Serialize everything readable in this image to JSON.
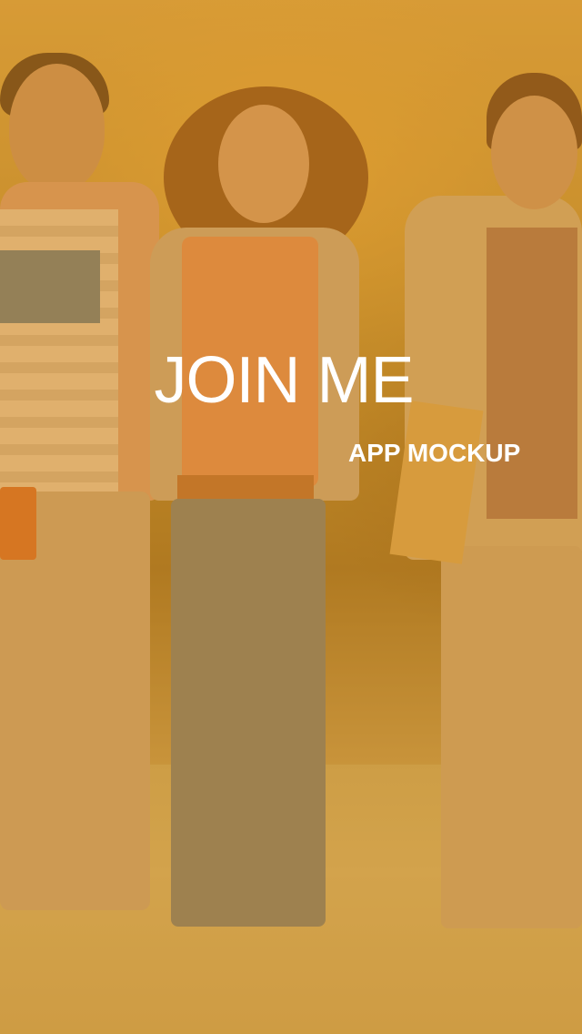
{
  "screen": {
    "title": "JOIN ME",
    "subtitle": "APP MOCKUP",
    "background_image": "students-walking-photo",
    "overlay_color": "#d68c20",
    "text_color": "#ffffff"
  }
}
